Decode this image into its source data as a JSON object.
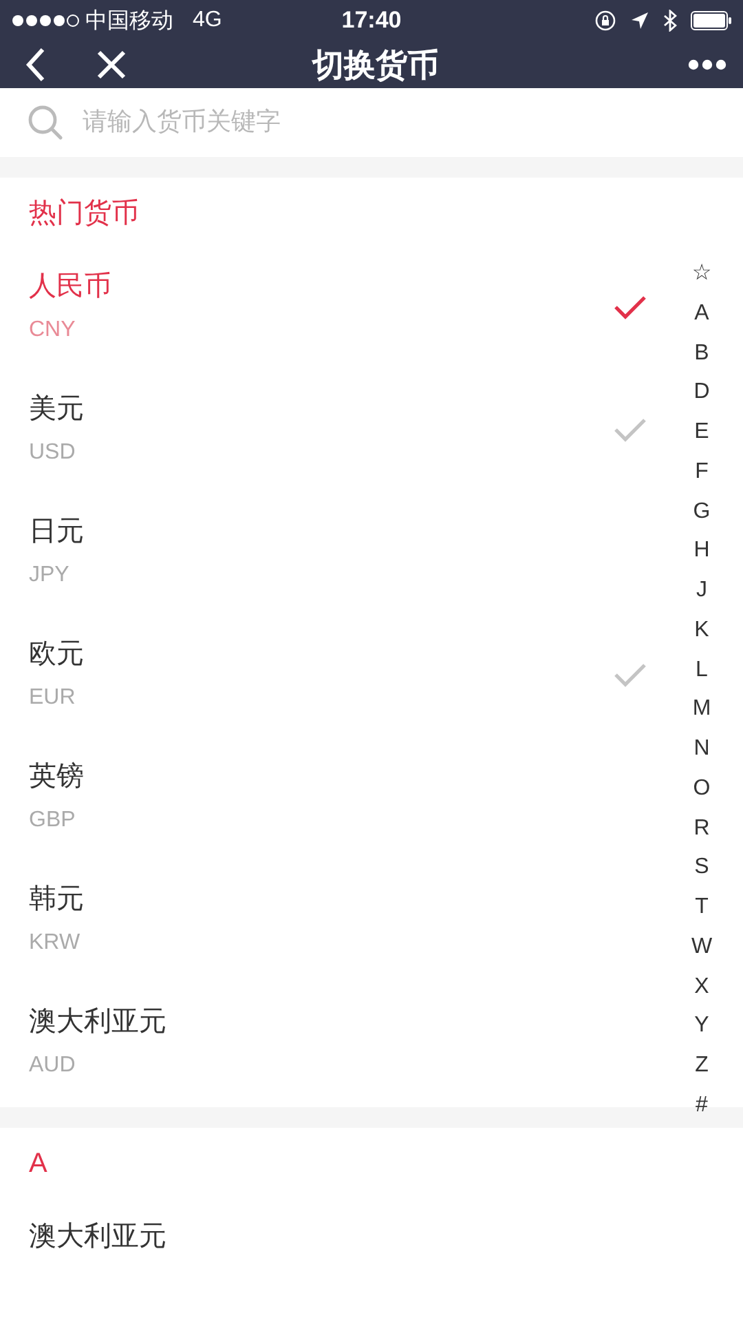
{
  "status_bar": {
    "carrier": "中国移动",
    "network": "4G",
    "time": "17:40"
  },
  "nav": {
    "title": "切换货币"
  },
  "search": {
    "placeholder": "请输入货币关键字"
  },
  "sections": [
    {
      "title": "热门货币",
      "items": [
        {
          "name": "人民币",
          "code": "CNY",
          "selected": true,
          "checked": true
        },
        {
          "name": "美元",
          "code": "USD",
          "selected": false,
          "checked": true
        },
        {
          "name": "日元",
          "code": "JPY",
          "selected": false,
          "checked": false
        },
        {
          "name": "欧元",
          "code": "EUR",
          "selected": false,
          "checked": true
        },
        {
          "name": "英镑",
          "code": "GBP",
          "selected": false,
          "checked": false
        },
        {
          "name": "韩元",
          "code": "KRW",
          "selected": false,
          "checked": false
        },
        {
          "name": "澳大利亚元",
          "code": "AUD",
          "selected": false,
          "checked": false
        }
      ]
    },
    {
      "title": "A",
      "items": [
        {
          "name": "澳大利亚元",
          "selected": false,
          "checked": false
        }
      ]
    }
  ],
  "index_bar": [
    "☆",
    "A",
    "B",
    "D",
    "E",
    "F",
    "G",
    "H",
    "J",
    "K",
    "L",
    "M",
    "N",
    "O",
    "R",
    "S",
    "T",
    "W",
    "X",
    "Y",
    "Z",
    "#"
  ]
}
